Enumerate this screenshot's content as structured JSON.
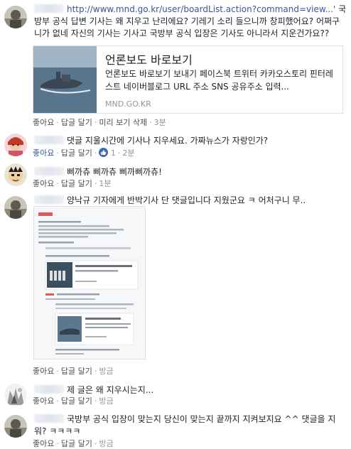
{
  "comments": [
    {
      "text_prefix": "",
      "text_link": "http://www.mnd.go.kr/user/boardList.action?command=view...'",
      "text": " 국방부 공식 답변 기사는 왜 지우고 난리에요? 기레기 소리 들으니까 창피했어요? 어쩌구니가 없네 자신의 기사는 기사고 국방부 공식 입장은 기사도 아니라서 지운건가요??",
      "actions": {
        "like": "좋아요",
        "reply": "답글 달기",
        "preview": "미리 보기 삭제",
        "time": "3분"
      }
    },
    {
      "text": "댓글 지울시간에 기사나 지우세요. 가짜뉴스가 자랑인가?",
      "actions": {
        "like": "좋아요",
        "reply": "답글 달기",
        "like_count": "1",
        "time": "2분"
      }
    },
    {
      "text": "삐까츄 삐까츄 삐까삐까츄!",
      "actions": {
        "like": "좋아요",
        "reply": "답글 달기",
        "time": "1분"
      }
    },
    {
      "text": "양낙규 기자에게 반박기사 단 댓글입니다 지웠군요 ㅋ 어처구니 무..",
      "actions": {
        "like": "좋아요",
        "reply": "답글 달기",
        "time": "방금"
      }
    },
    {
      "text": "제 글은 왜 지우시는지...",
      "actions": {
        "like": "좋아요",
        "reply": "답글 달기",
        "time": "방금"
      }
    },
    {
      "text": "국방부 공식 입장이 맞는지 당신이 맞는지 끝까지 지켜보지요 ^^ 댓글을 지워? ㅋㅋㅋㅋ",
      "actions": {
        "like": "좋아요",
        "reply": "답글 달기",
        "time": "방금"
      }
    }
  ],
  "link_preview": {
    "title": "언론보도 바로보기",
    "description": "언론보도 바로보기 보내기 페이스북 트위터 카카오스토리 핀터레스트 네이버블로그 URL 주소 SNS 공유주소 입력...",
    "domain": "MND.GO.KR"
  },
  "colors": {
    "link": "#365899",
    "like_badge": "#4267b2",
    "meta": "#90949c"
  }
}
